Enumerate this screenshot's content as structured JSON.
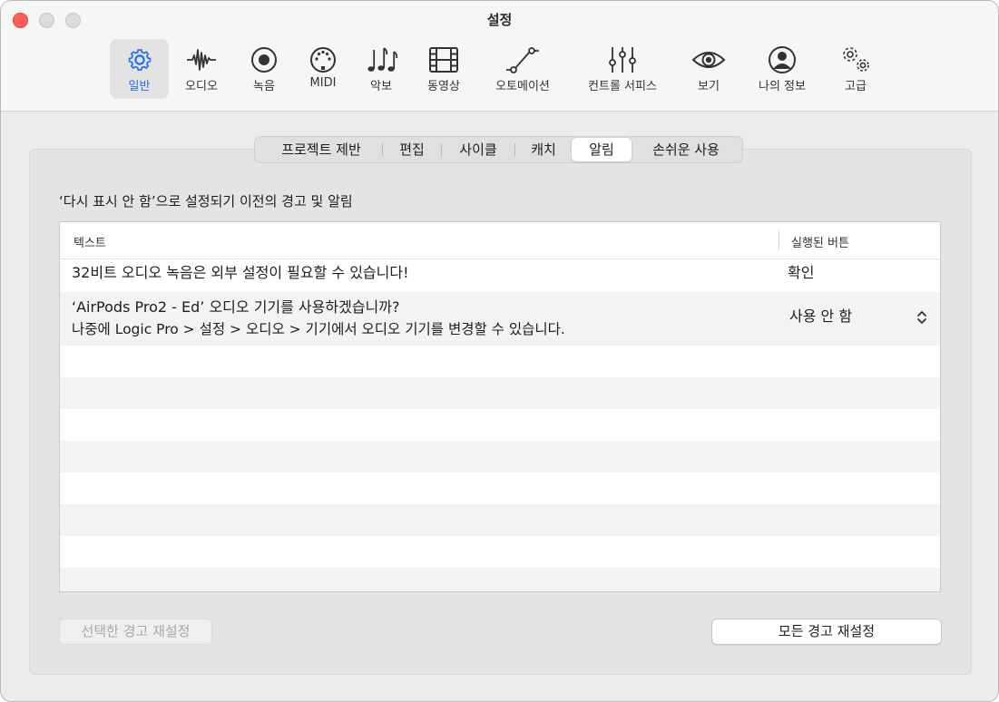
{
  "window": {
    "title": "설정"
  },
  "toolbar": {
    "items": [
      {
        "label": "일반",
        "icon": "gear-icon",
        "active": true
      },
      {
        "label": "오디오",
        "icon": "waveform-icon"
      },
      {
        "label": "녹음",
        "icon": "record-icon"
      },
      {
        "label": "MIDI",
        "icon": "midi-port-icon"
      },
      {
        "label": "악보",
        "icon": "music-notes-icon"
      },
      {
        "label": "동영상",
        "icon": "film-icon"
      },
      {
        "label": "오토메이션",
        "icon": "automation-curve-icon"
      },
      {
        "label": "컨트롤 서피스",
        "icon": "faders-icon"
      },
      {
        "label": "보기",
        "icon": "eye-icon"
      },
      {
        "label": "나의 정보",
        "icon": "person-circle-icon"
      },
      {
        "label": "고급",
        "icon": "gears-icon"
      }
    ]
  },
  "tabs": {
    "items": [
      {
        "label": "프로젝트 제반"
      },
      {
        "label": "편집"
      },
      {
        "label": "사이클"
      },
      {
        "label": "캐치"
      },
      {
        "label": "알림",
        "active": true
      },
      {
        "label": "손쉬운 사용"
      }
    ]
  },
  "section": {
    "title": "‘다시 표시 안 함’으로 설정되기 이전의 경고 및 알림"
  },
  "table": {
    "columns": {
      "text": "텍스트",
      "button": "실행된 버튼"
    },
    "rows": [
      {
        "line1": "32비트 오디오 녹음은 외부 설정이 필요할 수 있습니다!",
        "line2": "",
        "button": "확인"
      },
      {
        "line1": "‘AirPods Pro2 - Ed’ 오디오 기기를 사용하겠습니까?",
        "line2": "나중에 Logic Pro > 설정 > 오디오 > 기기에서 오디오 기기를 변경할 수 있습니다.",
        "button": "사용 안 함"
      }
    ]
  },
  "buttons": {
    "reset_selected": "선택한 경고 재설정",
    "reset_all": "모든 경고 재설정"
  },
  "colors": {
    "accent": "#1f6ff2",
    "close": "#ff5f57"
  }
}
